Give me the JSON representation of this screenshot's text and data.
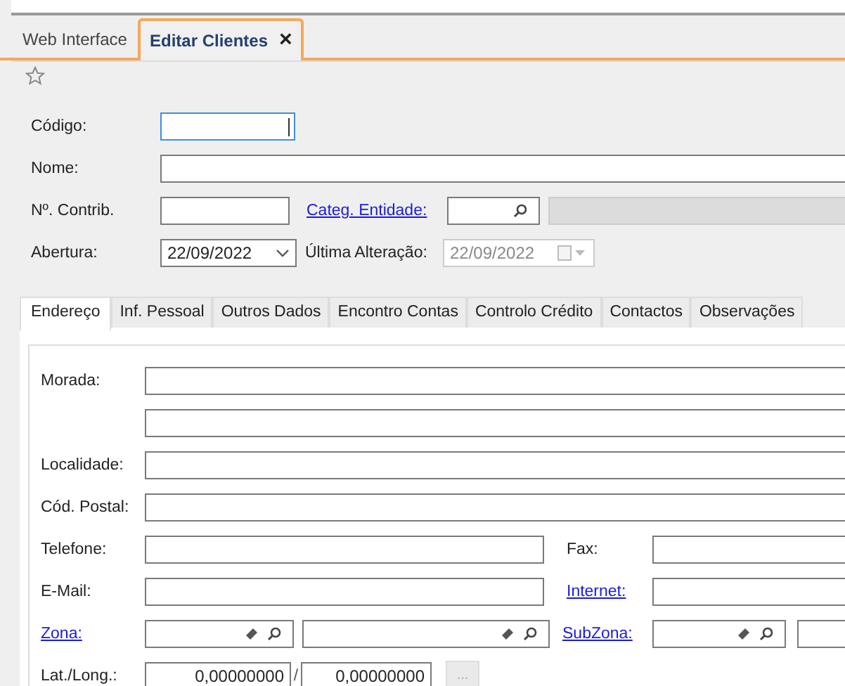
{
  "doc_tabs": [
    {
      "label": "Web Interface",
      "selected": false,
      "closable": false
    },
    {
      "label": "Editar Clientes",
      "selected": true,
      "closable": true
    }
  ],
  "close_glyph": "×",
  "header": {
    "codigo": {
      "label": "Código:",
      "focused": true
    },
    "nome": {
      "label": "Nome:"
    },
    "contrib": {
      "label": "Nº. Contrib."
    },
    "categ": {
      "label": "Categ. Entidade:"
    },
    "abertura": {
      "label": "Abertura:",
      "value": "22/09/2022"
    },
    "ultima": {
      "label": "Última Alteração:",
      "value": "22/09/2022",
      "disabled": true
    }
  },
  "page_tabs": [
    {
      "label": "Endereço",
      "selected": true
    },
    {
      "label": "Inf. Pessoal",
      "selected": false
    },
    {
      "label": "Outros Dados",
      "selected": false
    },
    {
      "label": "Encontro Contas",
      "selected": false
    },
    {
      "label": "Controlo Crédito",
      "selected": false
    },
    {
      "label": "Contactos",
      "selected": false
    },
    {
      "label": "Observações",
      "selected": false
    }
  ],
  "address": {
    "morada": "Morada:",
    "localidade": "Localidade:",
    "cod_postal": "Cód. Postal:",
    "telefone": "Telefone:",
    "fax": "Fax:",
    "email": "E-Mail:",
    "internet": "Internet:",
    "zona": "Zona:",
    "subzona": "SubZona:",
    "latlong": "Lat./Long.:",
    "lat": "0,00000000",
    "separator": "/",
    "long": "0,00000000",
    "more_button": "..."
  }
}
